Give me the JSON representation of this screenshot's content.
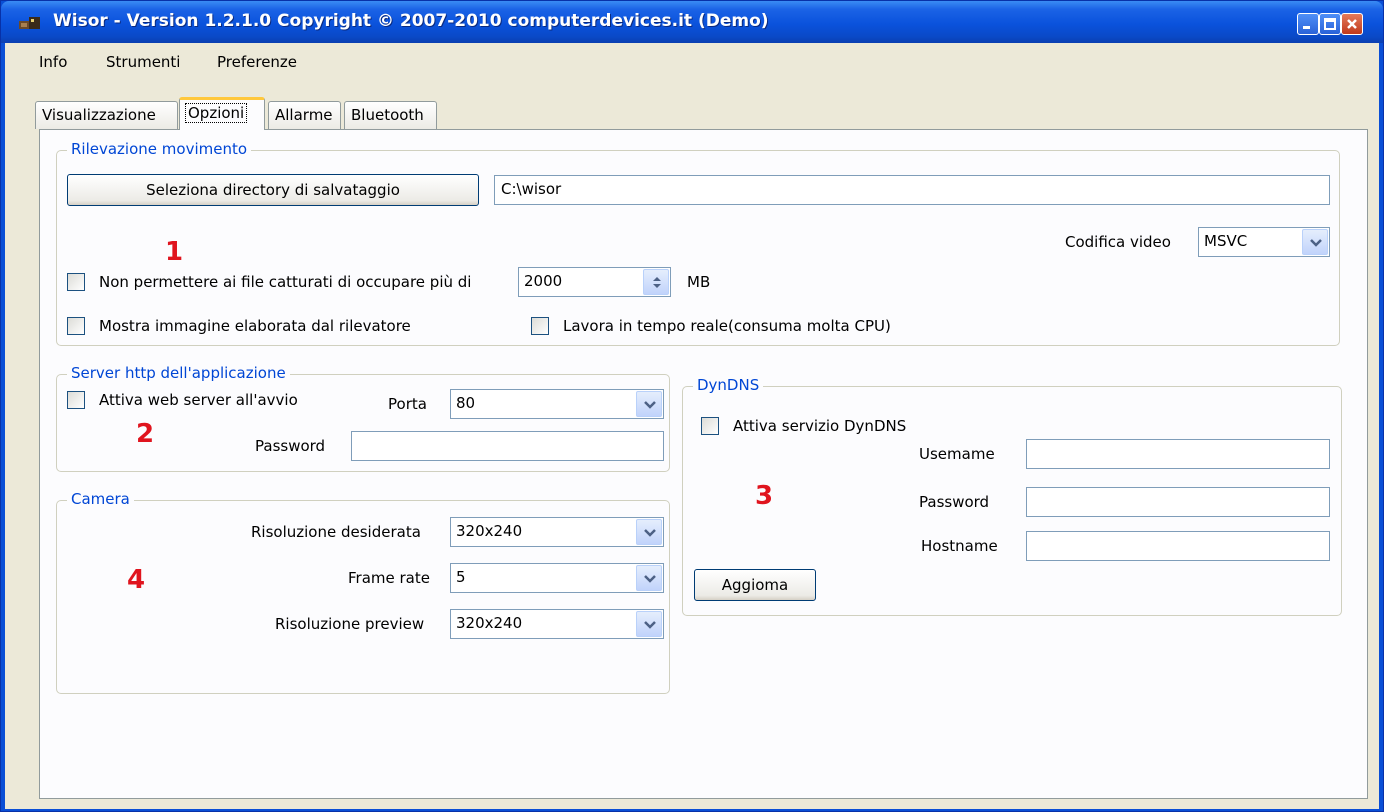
{
  "window": {
    "title": "Wisor - Version 1.2.1.0 Copyright © 2007-2010 computerdevices.it (Demo)"
  },
  "menu": [
    "Info",
    "Strumenti",
    "Preferenze"
  ],
  "tabs": [
    "Visualizzazione",
    "Opzioni",
    "Allarme",
    "Bluetooth"
  ],
  "motion": {
    "legend": "Rilevazione movimento",
    "select_dir_button": "Seleziona directory di salvataggio",
    "dir_value": "C:\\wisor",
    "codec_label": "Codifica video",
    "codec_value": "MSVC",
    "limit_checkbox": "Non permettere ai file catturati di occupare più di",
    "limit_value": "2000",
    "limit_unit": "MB",
    "show_processed": "Mostra immagine elaborata dal rilevatore",
    "realtime": "Lavora in tempo reale(consuma molta CPU)"
  },
  "http": {
    "legend": "Server http dell'applicazione",
    "autostart": "Attiva web server all'avvio",
    "port_label": "Porta",
    "port_value": "80",
    "password_label": "Password"
  },
  "dyndns": {
    "legend": "DynDNS",
    "enable": "Attiva servizio DynDNS",
    "username_label": "Usemame",
    "password_label": "Password",
    "hostname_label": "Hostname",
    "update_button": "Aggioma"
  },
  "camera": {
    "legend": "Camera",
    "resolution_label": "Risoluzione desiderata",
    "resolution_value": "320x240",
    "framerate_label": "Frame rate",
    "framerate_value": "5",
    "preview_label": "Risoluzione preview",
    "preview_value": "320x240"
  },
  "markers": [
    "1",
    "2",
    "3",
    "4"
  ],
  "colors": {
    "legend": "#0046d5",
    "marker": "#e0141e",
    "titlebar": "#0a52dc"
  },
  "icons": [
    "wisor-app-icon",
    "minimize-icon",
    "maximize-icon",
    "close-icon",
    "chevron-down-icon",
    "spin-arrows-icon"
  ]
}
